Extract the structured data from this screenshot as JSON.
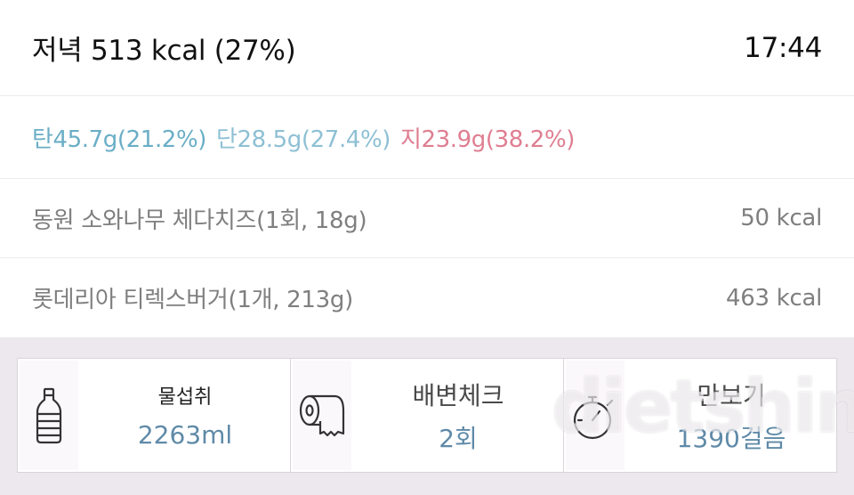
{
  "header": {
    "title": "저녁 513 kcal (27%)",
    "time": "17:44"
  },
  "macros": {
    "carb": "탄45.7g(21.2%)",
    "protein": "단28.5g(27.4%)",
    "fat": "지23.9g(38.2%)"
  },
  "foods": [
    {
      "name": "동원 소와나무 체다치즈(1회, 18g)",
      "kcal": "50 kcal"
    },
    {
      "name": "롯데리아 티렉스버거(1개, 213g)",
      "kcal": "463 kcal"
    }
  ],
  "trackers": {
    "water": {
      "label": "물섭취",
      "value": "2263ml",
      "icon": "water-bottle-icon"
    },
    "bowel": {
      "label": "배변체크",
      "value": "2회",
      "icon": "toilet-paper-icon"
    },
    "steps": {
      "label": "만보기",
      "value": "1390걸음",
      "icon": "stopwatch-icon"
    }
  },
  "watermark": "dietshin"
}
